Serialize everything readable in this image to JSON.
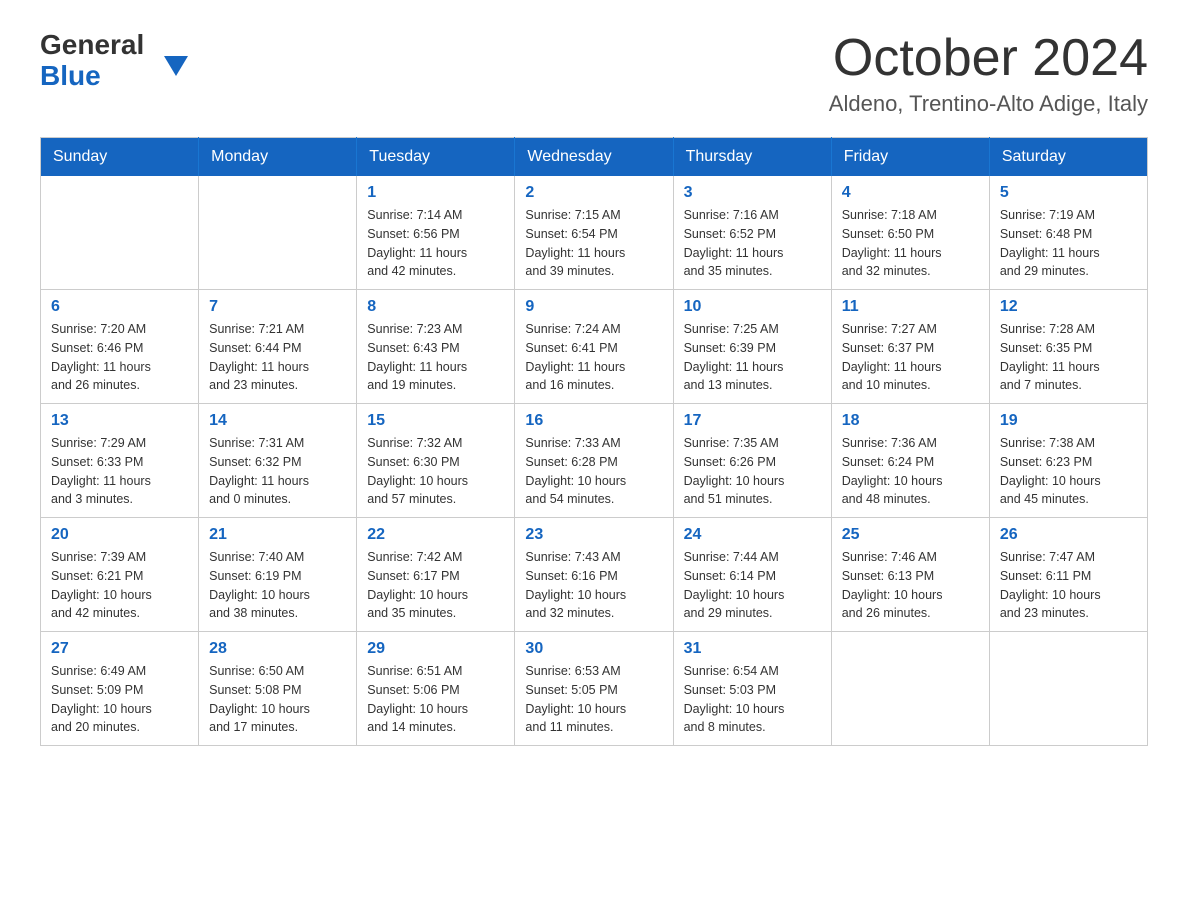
{
  "logo": {
    "general": "General",
    "blue": "Blue",
    "triangle_color": "#1565c0"
  },
  "title": {
    "month_year": "October 2024",
    "location": "Aldeno, Trentino-Alto Adige, Italy"
  },
  "header_color": "#1565c0",
  "days_of_week": [
    "Sunday",
    "Monday",
    "Tuesday",
    "Wednesday",
    "Thursday",
    "Friday",
    "Saturday"
  ],
  "weeks": [
    [
      {
        "day": "",
        "info": ""
      },
      {
        "day": "",
        "info": ""
      },
      {
        "day": "1",
        "info": "Sunrise: 7:14 AM\nSunset: 6:56 PM\nDaylight: 11 hours\nand 42 minutes."
      },
      {
        "day": "2",
        "info": "Sunrise: 7:15 AM\nSunset: 6:54 PM\nDaylight: 11 hours\nand 39 minutes."
      },
      {
        "day": "3",
        "info": "Sunrise: 7:16 AM\nSunset: 6:52 PM\nDaylight: 11 hours\nand 35 minutes."
      },
      {
        "day": "4",
        "info": "Sunrise: 7:18 AM\nSunset: 6:50 PM\nDaylight: 11 hours\nand 32 minutes."
      },
      {
        "day": "5",
        "info": "Sunrise: 7:19 AM\nSunset: 6:48 PM\nDaylight: 11 hours\nand 29 minutes."
      }
    ],
    [
      {
        "day": "6",
        "info": "Sunrise: 7:20 AM\nSunset: 6:46 PM\nDaylight: 11 hours\nand 26 minutes."
      },
      {
        "day": "7",
        "info": "Sunrise: 7:21 AM\nSunset: 6:44 PM\nDaylight: 11 hours\nand 23 minutes."
      },
      {
        "day": "8",
        "info": "Sunrise: 7:23 AM\nSunset: 6:43 PM\nDaylight: 11 hours\nand 19 minutes."
      },
      {
        "day": "9",
        "info": "Sunrise: 7:24 AM\nSunset: 6:41 PM\nDaylight: 11 hours\nand 16 minutes."
      },
      {
        "day": "10",
        "info": "Sunrise: 7:25 AM\nSunset: 6:39 PM\nDaylight: 11 hours\nand 13 minutes."
      },
      {
        "day": "11",
        "info": "Sunrise: 7:27 AM\nSunset: 6:37 PM\nDaylight: 11 hours\nand 10 minutes."
      },
      {
        "day": "12",
        "info": "Sunrise: 7:28 AM\nSunset: 6:35 PM\nDaylight: 11 hours\nand 7 minutes."
      }
    ],
    [
      {
        "day": "13",
        "info": "Sunrise: 7:29 AM\nSunset: 6:33 PM\nDaylight: 11 hours\nand 3 minutes."
      },
      {
        "day": "14",
        "info": "Sunrise: 7:31 AM\nSunset: 6:32 PM\nDaylight: 11 hours\nand 0 minutes."
      },
      {
        "day": "15",
        "info": "Sunrise: 7:32 AM\nSunset: 6:30 PM\nDaylight: 10 hours\nand 57 minutes."
      },
      {
        "day": "16",
        "info": "Sunrise: 7:33 AM\nSunset: 6:28 PM\nDaylight: 10 hours\nand 54 minutes."
      },
      {
        "day": "17",
        "info": "Sunrise: 7:35 AM\nSunset: 6:26 PM\nDaylight: 10 hours\nand 51 minutes."
      },
      {
        "day": "18",
        "info": "Sunrise: 7:36 AM\nSunset: 6:24 PM\nDaylight: 10 hours\nand 48 minutes."
      },
      {
        "day": "19",
        "info": "Sunrise: 7:38 AM\nSunset: 6:23 PM\nDaylight: 10 hours\nand 45 minutes."
      }
    ],
    [
      {
        "day": "20",
        "info": "Sunrise: 7:39 AM\nSunset: 6:21 PM\nDaylight: 10 hours\nand 42 minutes."
      },
      {
        "day": "21",
        "info": "Sunrise: 7:40 AM\nSunset: 6:19 PM\nDaylight: 10 hours\nand 38 minutes."
      },
      {
        "day": "22",
        "info": "Sunrise: 7:42 AM\nSunset: 6:17 PM\nDaylight: 10 hours\nand 35 minutes."
      },
      {
        "day": "23",
        "info": "Sunrise: 7:43 AM\nSunset: 6:16 PM\nDaylight: 10 hours\nand 32 minutes."
      },
      {
        "day": "24",
        "info": "Sunrise: 7:44 AM\nSunset: 6:14 PM\nDaylight: 10 hours\nand 29 minutes."
      },
      {
        "day": "25",
        "info": "Sunrise: 7:46 AM\nSunset: 6:13 PM\nDaylight: 10 hours\nand 26 minutes."
      },
      {
        "day": "26",
        "info": "Sunrise: 7:47 AM\nSunset: 6:11 PM\nDaylight: 10 hours\nand 23 minutes."
      }
    ],
    [
      {
        "day": "27",
        "info": "Sunrise: 6:49 AM\nSunset: 5:09 PM\nDaylight: 10 hours\nand 20 minutes."
      },
      {
        "day": "28",
        "info": "Sunrise: 6:50 AM\nSunset: 5:08 PM\nDaylight: 10 hours\nand 17 minutes."
      },
      {
        "day": "29",
        "info": "Sunrise: 6:51 AM\nSunset: 5:06 PM\nDaylight: 10 hours\nand 14 minutes."
      },
      {
        "day": "30",
        "info": "Sunrise: 6:53 AM\nSunset: 5:05 PM\nDaylight: 10 hours\nand 11 minutes."
      },
      {
        "day": "31",
        "info": "Sunrise: 6:54 AM\nSunset: 5:03 PM\nDaylight: 10 hours\nand 8 minutes."
      },
      {
        "day": "",
        "info": ""
      },
      {
        "day": "",
        "info": ""
      }
    ]
  ]
}
